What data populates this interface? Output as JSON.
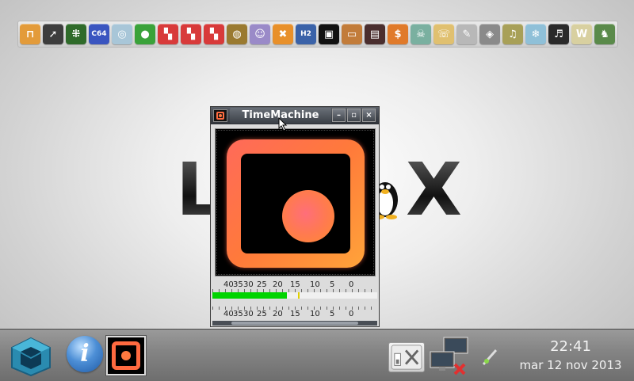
{
  "dock": {
    "icons": [
      {
        "name": "app-launcher-icon",
        "glyph": "⊓",
        "bg": "#e39b3a"
      },
      {
        "name": "compass-icon",
        "glyph": "➚",
        "bg": "#3d3d3d"
      },
      {
        "name": "chip-icon",
        "glyph": "⁜",
        "bg": "#2f6b2a"
      },
      {
        "name": "c64-emulator-icon",
        "glyph": "C64",
        "bg": "#3a55c0"
      },
      {
        "name": "globe-icon",
        "glyph": "◎",
        "bg": "#a8c6d8"
      },
      {
        "name": "green-circle-icon",
        "glyph": "●",
        "bg": "#3aa23a"
      },
      {
        "name": "colored-blocks-icon-1",
        "glyph": "▚",
        "bg": "#d83a3a"
      },
      {
        "name": "colored-blocks-icon-2",
        "glyph": "▚",
        "bg": "#d83a3a"
      },
      {
        "name": "colored-blocks-icon-3",
        "glyph": "▚",
        "bg": "#d83a3a"
      },
      {
        "name": "planet-icon",
        "glyph": "◍",
        "bg": "#9a7a30"
      },
      {
        "name": "ghost-icon",
        "glyph": "☺",
        "bg": "#9a8ac8"
      },
      {
        "name": "x-circle-icon",
        "glyph": "✖",
        "bg": "#e8902a"
      },
      {
        "name": "h2-icon",
        "glyph": "H2",
        "bg": "#3a62a8"
      },
      {
        "name": "timemachine-icon",
        "glyph": "▣",
        "bg": "#111111"
      },
      {
        "name": "tv-icon",
        "glyph": "▭",
        "bg": "#c27c3a"
      },
      {
        "name": "media-player-icon",
        "glyph": "▤",
        "bg": "#4a2e2e"
      },
      {
        "name": "dollar-icon",
        "glyph": "$",
        "bg": "#e07a2a"
      },
      {
        "name": "skull-icon",
        "glyph": "☠",
        "bg": "#7ab0a0"
      },
      {
        "name": "fax-icon",
        "glyph": "☏",
        "bg": "#e0c070"
      },
      {
        "name": "pencil-icon",
        "glyph": "✎",
        "bg": "#b8b8b8"
      },
      {
        "name": "shield-icon",
        "glyph": "◈",
        "bg": "#8a8a8a"
      },
      {
        "name": "gramophone-icon",
        "glyph": "♫",
        "bg": "#a8a058"
      },
      {
        "name": "ice-icon",
        "glyph": "❄",
        "bg": "#8fc0d8"
      },
      {
        "name": "piano-icon",
        "glyph": "♬",
        "bg": "#2a2a2a"
      },
      {
        "name": "wine-icon",
        "glyph": "W",
        "bg": "#d8d0a0"
      },
      {
        "name": "dragon-icon",
        "glyph": "♞",
        "bg": "#5a8a4a"
      }
    ]
  },
  "window": {
    "title": "TimeMachine",
    "minimize_glyph": "–",
    "maximize_glyph": "▫",
    "close_glyph": "×",
    "scale_labels": [
      "40",
      "35",
      "30",
      "25",
      "20",
      "15",
      "10",
      "5",
      "0"
    ],
    "meter_level_fraction": 0.45,
    "meter_peak_fraction": 0.52
  },
  "taskbar": {
    "clock_time": "22:41",
    "clock_date": "mar 12 nov 2013"
  },
  "colors": {
    "accent_orange": "#ff6a40",
    "meter_green": "#00d400"
  }
}
